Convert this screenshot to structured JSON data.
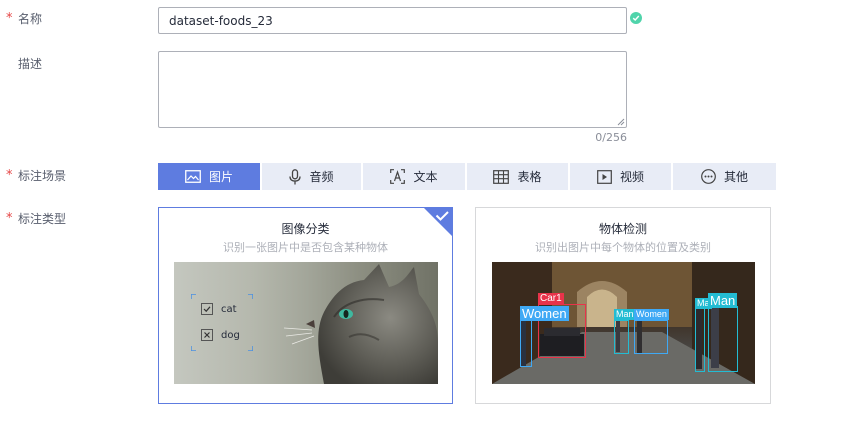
{
  "form": {
    "name": {
      "label": "名称",
      "value": "dataset-foods_23"
    },
    "description": {
      "label": "描述",
      "value": "",
      "counter": "0/256"
    },
    "scene": {
      "label": "标注场景",
      "tabs": [
        {
          "label": "图片",
          "icon": "image-icon",
          "active": true
        },
        {
          "label": "音频",
          "icon": "microphone-icon",
          "active": false
        },
        {
          "label": "文本",
          "icon": "text-icon",
          "active": false
        },
        {
          "label": "表格",
          "icon": "table-icon",
          "active": false
        },
        {
          "label": "视频",
          "icon": "video-icon",
          "active": false
        },
        {
          "label": "其他",
          "icon": "more-icon",
          "active": false
        }
      ]
    },
    "type": {
      "label": "标注类型",
      "cards": [
        {
          "title": "图像分类",
          "subtitle": "识别一张图片中是否包含某种物体",
          "selected": true,
          "options": [
            "cat",
            "dog"
          ]
        },
        {
          "title": "物体检测",
          "subtitle": "识别出图片中每个物体的位置及类别",
          "selected": false,
          "tags": [
            "Car1",
            "Women",
            "Man",
            "Women",
            "Ma",
            "Man"
          ]
        }
      ]
    }
  },
  "colors": {
    "accent": "#5e7ce0",
    "required": "#e54545",
    "valid": "#50d4ab",
    "tab_inactive": "#e8ecf6"
  }
}
